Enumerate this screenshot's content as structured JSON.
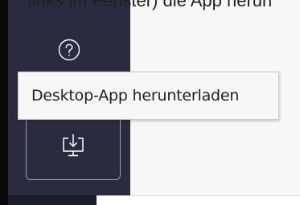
{
  "caption_fragment": "links im Fenster) die App herun",
  "sidebar": {
    "help_icon": "question-circle-icon",
    "download_icon": "monitor-download-icon"
  },
  "tooltip": {
    "text": "Desktop-App herunterladen"
  },
  "colors": {
    "sidebar_bg": "#2b2b40",
    "icon_color": "#ffffff",
    "button_border": "#9fa0a8",
    "tooltip_bg": "#f7f7f7"
  }
}
